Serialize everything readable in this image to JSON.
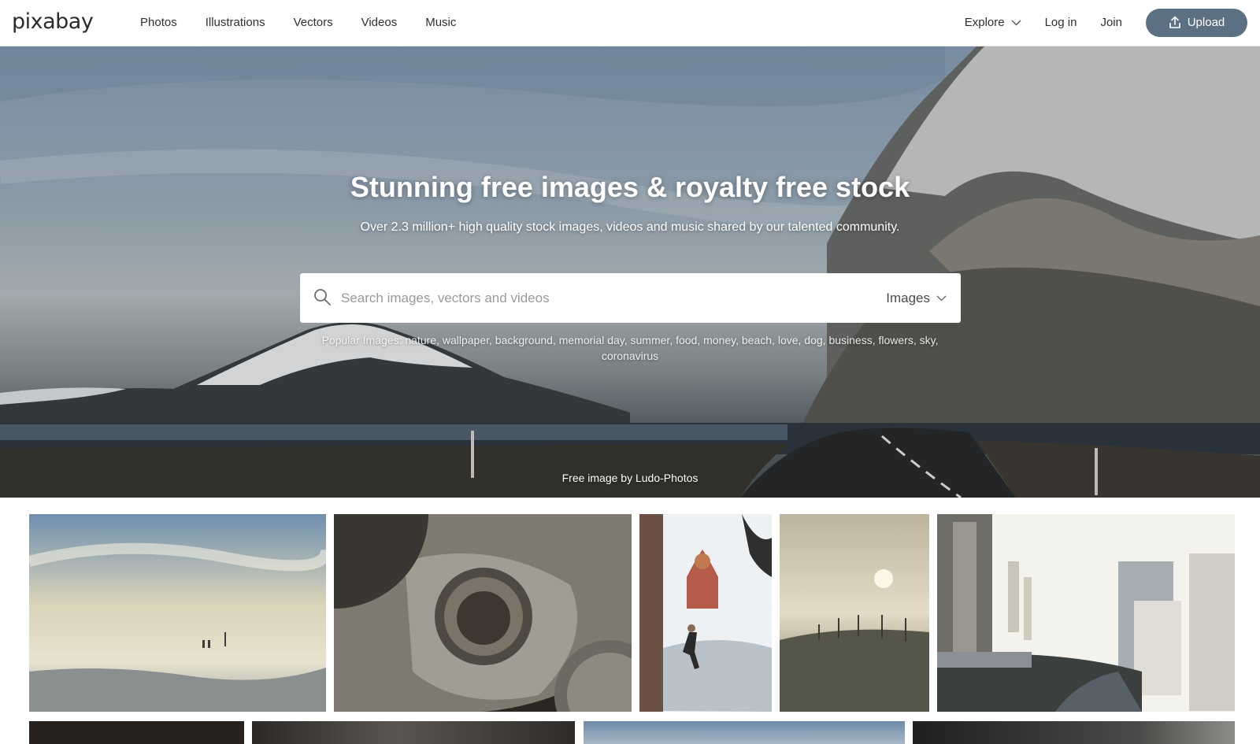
{
  "header": {
    "logo": "pixabay",
    "nav": [
      "Photos",
      "Illustrations",
      "Vectors",
      "Videos",
      "Music"
    ],
    "explore": "Explore",
    "login": "Log in",
    "join": "Join",
    "upload": "Upload"
  },
  "hero": {
    "title": "Stunning free images & royalty free stock",
    "subtitle": "Over 2.3 million+ high quality stock images, videos and music shared by our talented community.",
    "search_placeholder": "Search images, vectors and videos",
    "search_type": "Images",
    "popular_prefix": "Popular Images:",
    "popular_tags": [
      "nature",
      "wallpaper",
      "background",
      "memorial day",
      "summer",
      "food",
      "money",
      "beach",
      "love",
      "dog",
      "business",
      "flowers",
      "sky",
      "coronavirus"
    ],
    "credit": "Free image by Ludo-Photos"
  },
  "colors": {
    "upload_button": "#5b7082",
    "text_dark": "#2f2f2f",
    "header_border": "#e6e6e6"
  },
  "icons": [
    "search-icon",
    "chevron-down-icon",
    "upload-icon"
  ]
}
